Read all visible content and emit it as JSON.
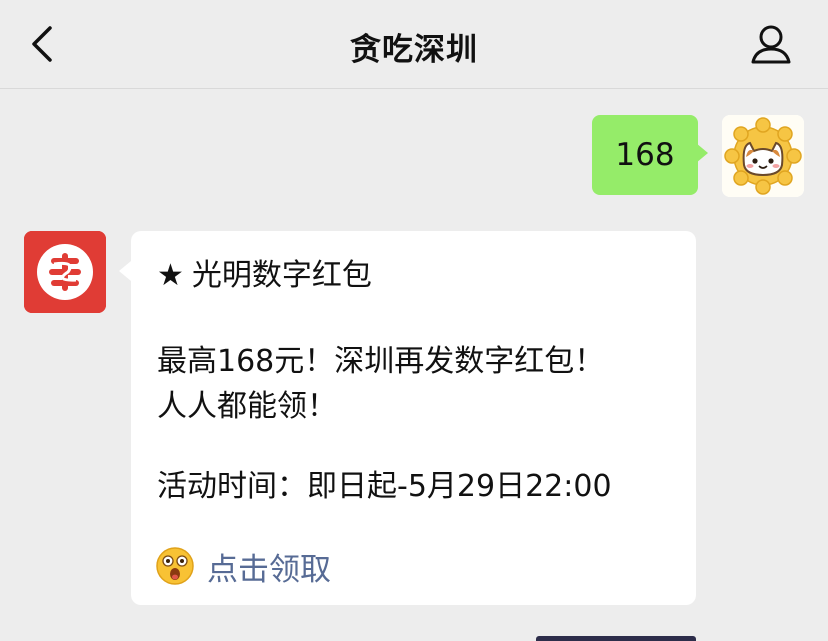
{
  "header": {
    "title": "贪吃深圳"
  },
  "messages": {
    "sent_text": "168",
    "card": {
      "title": "光明数字红包",
      "line1": "最高168元！深圳再发数字红包！",
      "line2": "人人都能领！",
      "line3": "活动时间：即日起-5月29日22:00",
      "link_label": "点击领取"
    }
  },
  "colors": {
    "background": "#ededed",
    "sent_bubble": "#95ec69",
    "link": "#576b95",
    "bot_avatar": "#e03c35"
  },
  "icons": {
    "back": "chevron-left-icon",
    "profile": "person-icon",
    "star": "star-icon",
    "emoji": "surprised-emoji-icon"
  }
}
